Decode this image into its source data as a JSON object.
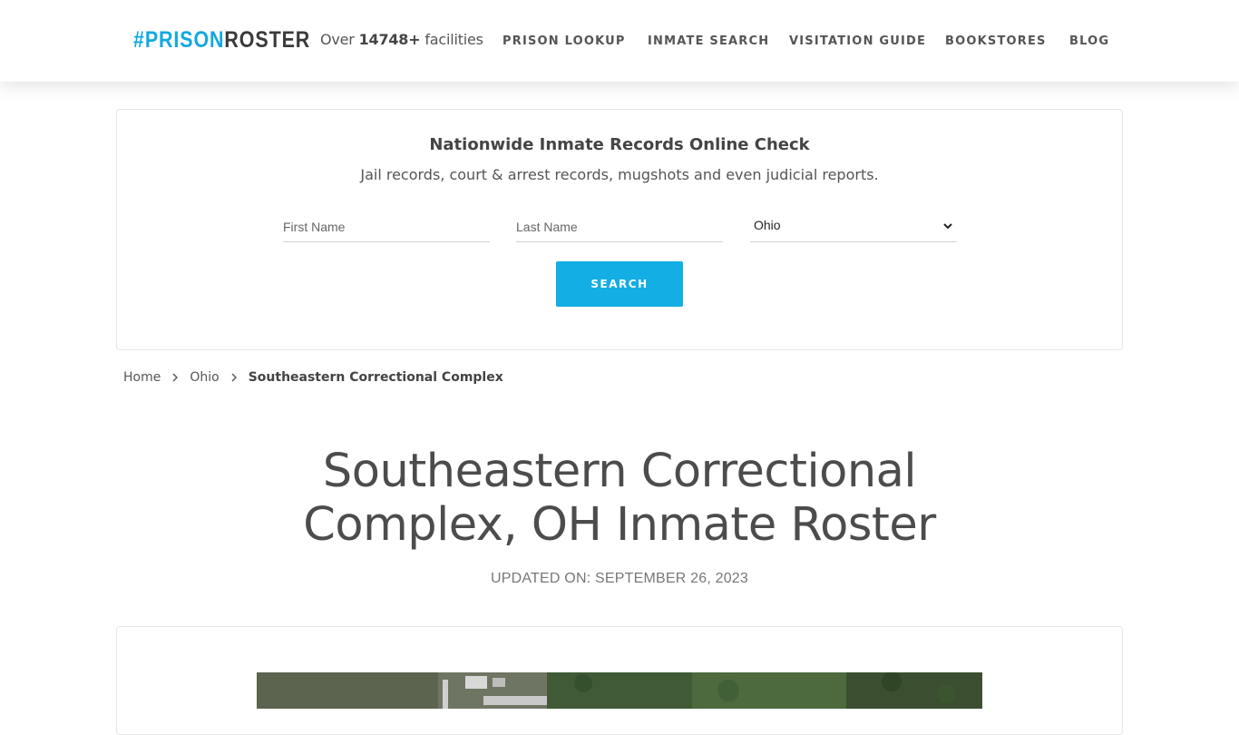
{
  "header": {
    "logo": {
      "hash": "#",
      "prison": "PRISON",
      "roster": "ROSTER"
    },
    "facilities": {
      "prefix": "Over",
      "count": "14748+",
      "suffix": "facilities"
    },
    "nav": [
      {
        "label": "PRISON LOOKUP"
      },
      {
        "label": "INMATE SEARCH"
      },
      {
        "label": "VISITATION GUIDE"
      },
      {
        "label": "BOOKSTORES"
      },
      {
        "label": "BLOG"
      }
    ]
  },
  "search": {
    "title": "Nationwide Inmate Records Online Check",
    "subtitle": "Jail records, court & arrest records, mugshots and even judicial reports.",
    "first_name_placeholder": "First Name",
    "last_name_placeholder": "Last Name",
    "state_selected": "Ohio",
    "button_label": "SEARCH"
  },
  "breadcrumb": {
    "home": "Home",
    "state": "Ohio",
    "current": "Southeastern Correctional Complex"
  },
  "page": {
    "title_line1": "Southeastern Correctional",
    "title_line2": "Complex, OH Inmate Roster",
    "updated": "UPDATED ON: SEPTEMBER 26, 2023"
  },
  "colors": {
    "accent": "#12aee4",
    "logo_blue": "#12a8e0",
    "text_dark": "#4a4a4a"
  },
  "icons": {
    "breadcrumb_separator": "chevron-right-icon",
    "select_arrow": "chevron-down-icon"
  }
}
